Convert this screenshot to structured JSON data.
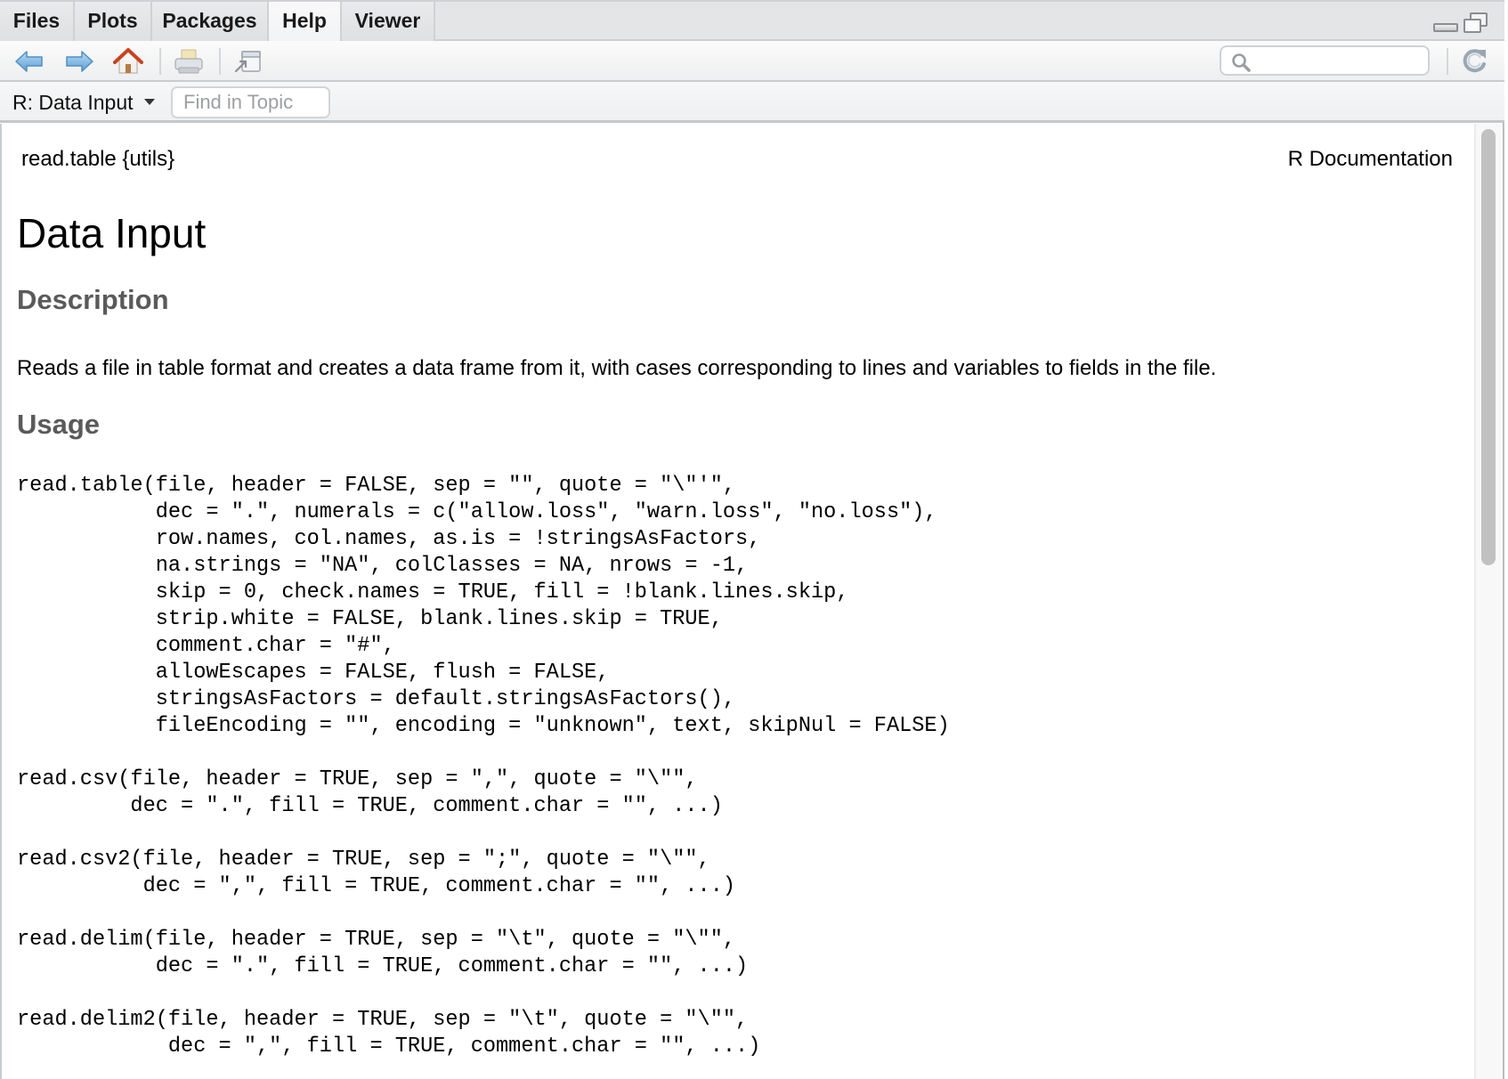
{
  "tabs": [
    {
      "label": "Files",
      "active": false
    },
    {
      "label": "Plots",
      "active": false
    },
    {
      "label": "Packages",
      "active": false
    },
    {
      "label": "Help",
      "active": true
    },
    {
      "label": "Viewer",
      "active": false
    }
  ],
  "toolbar": {
    "icons": [
      "back-arrow-icon",
      "forward-arrow-icon",
      "home-icon",
      "print-icon",
      "open-in-new-window-icon",
      "search-icon",
      "refresh-icon"
    ],
    "search": {
      "value": "",
      "placeholder": ""
    }
  },
  "topic_bar": {
    "topic_label": "R: Data Input",
    "find_placeholder": "Find in Topic",
    "find_value": ""
  },
  "doc": {
    "header_left": "read.table {utils}",
    "header_right": "R Documentation",
    "title": "Data Input",
    "sections": {
      "description_heading": "Description",
      "description_text": "Reads a file in table format and creates a data frame from it, with cases corresponding to lines and variables to fields in the file.",
      "usage_heading": "Usage"
    },
    "usage_code": "read.table(file, header = FALSE, sep = \"\", quote = \"\\\"'\",\n           dec = \".\", numerals = c(\"allow.loss\", \"warn.loss\", \"no.loss\"),\n           row.names, col.names, as.is = !stringsAsFactors,\n           na.strings = \"NA\", colClasses = NA, nrows = -1,\n           skip = 0, check.names = TRUE, fill = !blank.lines.skip,\n           strip.white = FALSE, blank.lines.skip = TRUE,\n           comment.char = \"#\",\n           allowEscapes = FALSE, flush = FALSE,\n           stringsAsFactors = default.stringsAsFactors(),\n           fileEncoding = \"\", encoding = \"unknown\", text, skipNul = FALSE)\n\nread.csv(file, header = TRUE, sep = \",\", quote = \"\\\"\",\n         dec = \".\", fill = TRUE, comment.char = \"\", ...)\n\nread.csv2(file, header = TRUE, sep = \";\", quote = \"\\\"\",\n          dec = \",\", fill = TRUE, comment.char = \"\", ...)\n\nread.delim(file, header = TRUE, sep = \"\\t\", quote = \"\\\"\",\n           dec = \".\", fill = TRUE, comment.char = \"\", ...)\n\nread.delim2(file, header = TRUE, sep = \"\\t\", quote = \"\\\"\",\n            dec = \",\", fill = TRUE, comment.char = \"\", ...)"
  },
  "colors": {
    "section_heading": "#5a5a5a",
    "home_roof": "#c8431f",
    "arrow_blue": "#7fb6e0"
  }
}
